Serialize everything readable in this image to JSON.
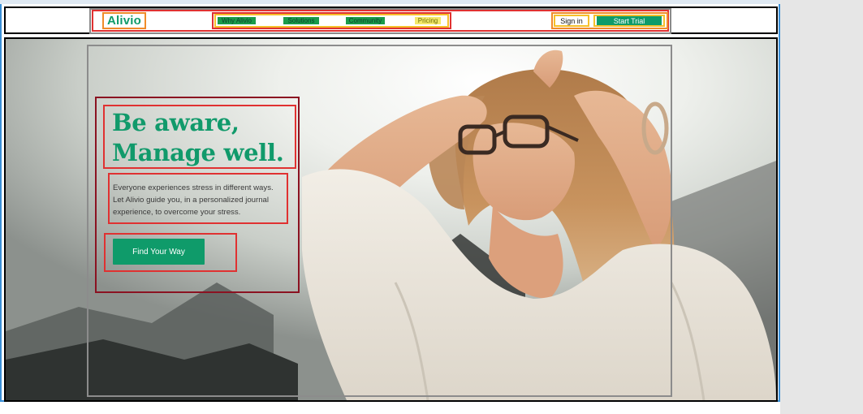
{
  "header": {
    "logo": "Alivio",
    "nav": [
      "Why Alivio",
      "Solutions",
      "Community",
      "Pricing"
    ],
    "sign_in": "Sign in",
    "start_trial": "Start Trial"
  },
  "hero": {
    "headline_line1": "Be aware,",
    "headline_line2": "Manage well.",
    "subtext": "Everyone experiences stress in different ways. Let Alivio guide you, in a personalized journal experience, to overcome your stress.",
    "cta": "Find Your Way"
  },
  "colors": {
    "brand_green": "#0f9b6a",
    "page_bg": "#e6e6e6"
  }
}
